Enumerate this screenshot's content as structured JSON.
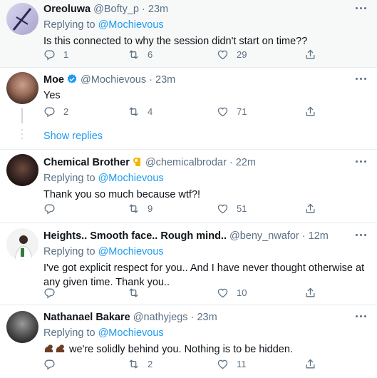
{
  "replying_label": "Replying to",
  "tweets": [
    {
      "name": "Oreoluwa",
      "handle": "@Bofty_p",
      "dot": "·",
      "time": "23m",
      "reply_to": "@Mochievous",
      "text": "Is this connected to why the session didn't start on time??",
      "replies": "1",
      "retweets": "6",
      "likes": "29"
    },
    {
      "name": "Moe",
      "handle": "@Mochievous",
      "dot": "·",
      "time": "23m",
      "reply_to": "",
      "text": "Yes",
      "replies": "2",
      "retweets": "4",
      "likes": "71",
      "verified": true
    },
    {
      "name": "Chemical Brother",
      "handle": "@chemicalbrodar",
      "dot": "·",
      "time": "22m",
      "reply_to": "@Mochievous",
      "text": "Thank you so much because wtf?!",
      "replies": "",
      "retweets": "9",
      "likes": "51"
    },
    {
      "name": "Heights.. Smooth face.. Rough mind..",
      "handle": "@beny_nwafor",
      "dot": "·",
      "time": "12m",
      "reply_to": "@Mochievous",
      "text": "I've got explicit respect for you.. And I have never thought otherwise at any given time. Thank you..",
      "replies": "",
      "retweets": "",
      "likes": "10"
    },
    {
      "name": "Nathanael Bakare",
      "handle": "@nathyjegs",
      "dot": "·",
      "time": "23m",
      "reply_to": "@Mochievous",
      "text": "we're solidly behind you. Nothing is to be hidden.",
      "replies": "",
      "retweets": "2",
      "likes": "11"
    }
  ],
  "show_replies": "Show replies",
  "icons": {
    "reply": "reply-icon",
    "retweet": "retweet-icon",
    "like": "like-icon",
    "share": "share-icon",
    "more": "more-icon",
    "verified": "verified-badge-icon",
    "ok_hand": "ok-hand-emoji",
    "flex": "flexed-biceps-emoji"
  },
  "colors": {
    "link": "#1d9bf0",
    "muted": "#5b7083",
    "text": "#0f1419",
    "highlight_bg": "#f7f9f9"
  }
}
